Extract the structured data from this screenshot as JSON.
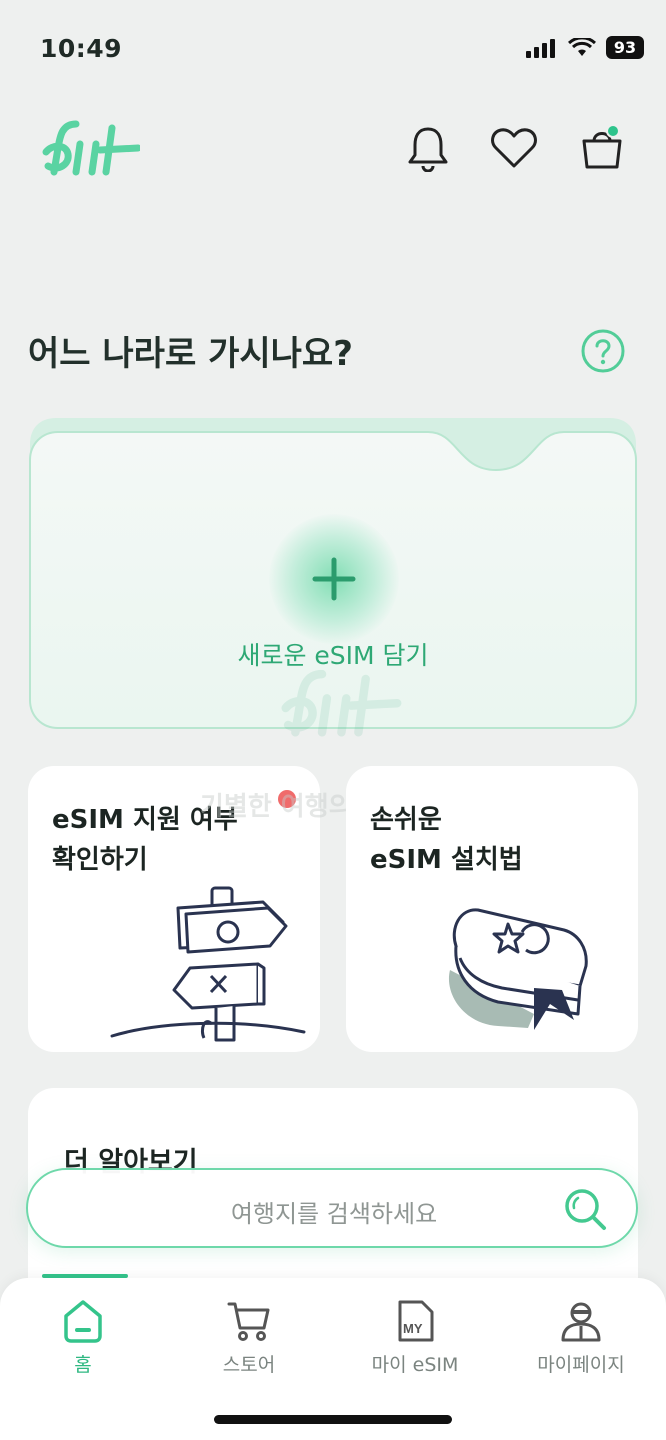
{
  "status_bar": {
    "time": "10:49",
    "battery": "93"
  },
  "header": {
    "logo_alt": "fiit",
    "icons": [
      "bell-icon",
      "heart-icon",
      "shopping-bag-icon"
    ],
    "cart_badge_color": "#2ec48c"
  },
  "main": {
    "question": "어느 나라로 가시나요?",
    "add_esim_label": "새로운 eSIM 담기",
    "cards": [
      {
        "title_line1": "eSIM 지원 여부",
        "title_line2": "확인하기"
      },
      {
        "title_line1": "손쉬운",
        "title_line2": "eSIM 설치법"
      }
    ],
    "faded_text": "기별한 여행의 시작",
    "more_title": "더 알아보기"
  },
  "search": {
    "placeholder": "여행지를 검색하세요"
  },
  "nav": {
    "items": [
      {
        "label": "홈",
        "icon": "home-icon",
        "active": true
      },
      {
        "label": "스토어",
        "icon": "cart-icon",
        "active": false
      },
      {
        "label": "마이 eSIM",
        "icon": "sim-card-icon",
        "active": false
      },
      {
        "label": "마이페이지",
        "icon": "user-icon",
        "active": false
      }
    ]
  },
  "colors": {
    "accent": "#34c48b",
    "background": "#eef0ef",
    "notification_dot": "#f06b6b"
  }
}
